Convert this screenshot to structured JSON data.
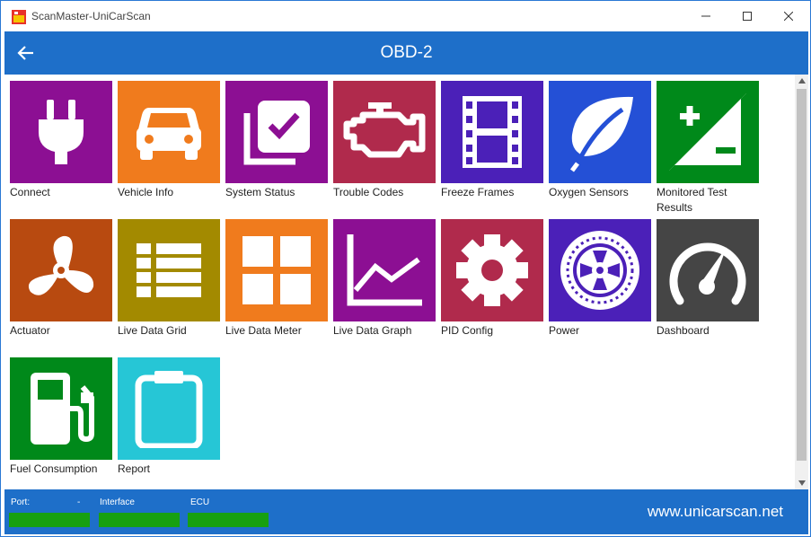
{
  "window": {
    "title": "ScanMaster-UniCarScan",
    "minimize_icon": "minimize-icon",
    "maximize_icon": "maximize-icon",
    "close_icon": "close-icon"
  },
  "appbar": {
    "title": "OBD-2",
    "back_icon": "arrow-left-icon"
  },
  "tiles": [
    {
      "label": "Connect",
      "color": "#8c0f93",
      "icon": "plug-icon"
    },
    {
      "label": "Vehicle Info",
      "color": "#f07b1d",
      "icon": "car-icon"
    },
    {
      "label": "System Status",
      "color": "#8c0f93",
      "icon": "checkbox-icon"
    },
    {
      "label": "Trouble Codes",
      "color": "#b02a4c",
      "icon": "engine-icon"
    },
    {
      "label": "Freeze Frames",
      "color": "#4b20b8",
      "icon": "film-icon"
    },
    {
      "label": "Oxygen Sensors",
      "color": "#2450d6",
      "icon": "leaf-icon"
    },
    {
      "label": "Monitored Test Results",
      "color": "#00891a",
      "icon": "plus-minus-icon"
    },
    {
      "label": "Actuator",
      "color": "#b84a10",
      "icon": "fan-icon"
    },
    {
      "label": "Live Data Grid",
      "color": "#a38a00",
      "icon": "list-grid-icon"
    },
    {
      "label": "Live Data Meter",
      "color": "#f07b1d",
      "icon": "four-squares-icon"
    },
    {
      "label": "Live Data Graph",
      "color": "#8c0f93",
      "icon": "line-graph-icon"
    },
    {
      "label": "PID Config",
      "color": "#b02a4c",
      "icon": "gear-icon"
    },
    {
      "label": "Power",
      "color": "#4b20b8",
      "icon": "wheel-icon"
    },
    {
      "label": "Dashboard",
      "color": "#454545",
      "icon": "gauge-icon"
    },
    {
      "label": "Fuel Consumption",
      "color": "#00891a",
      "icon": "fuel-pump-icon"
    },
    {
      "label": "Report",
      "color": "#26c6d6",
      "icon": "clipboard-icon"
    }
  ],
  "footer": {
    "port_label": "Port:",
    "port_value": "-",
    "interface_label": "Interface",
    "ecu_label": "ECU",
    "website": "www.unicarscan.net",
    "status_color": "#17a011"
  }
}
